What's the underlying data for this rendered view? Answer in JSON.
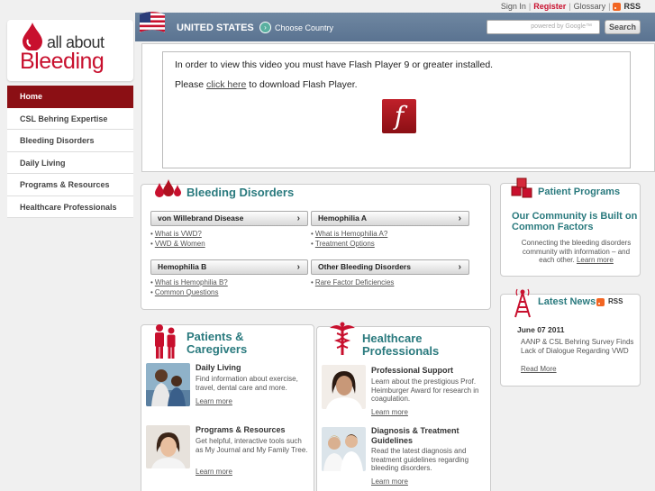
{
  "util": {
    "signin": "Sign In",
    "register": "Register",
    "glossary": "Glossary",
    "rss": "RSS"
  },
  "header": {
    "country": "UNITED STATES",
    "choose": "Choose Country",
    "search_placeholder": "powered by Google™",
    "search_button": "Search"
  },
  "logo": {
    "line1": "all about",
    "line2": "Bleeding"
  },
  "nav": [
    {
      "label": "Home"
    },
    {
      "label": "CSL Behring Expertise"
    },
    {
      "label": "Bleeding Disorders"
    },
    {
      "label": "Daily Living"
    },
    {
      "label": "Programs & Resources"
    },
    {
      "label": "Healthcare Professionals"
    }
  ],
  "video": {
    "msg1": "In order to view this video you must have Flash Player 9 or greater installed.",
    "msg2_pre": "Please ",
    "msg2_link": "click here",
    "msg2_post": " to download Flash Player.",
    "flash_glyph": "f"
  },
  "bleeding": {
    "title": "Bleeding Disorders",
    "vwd": {
      "label": "von Willebrand Disease",
      "links": [
        "What is VWD?",
        "VWD & Women"
      ]
    },
    "hemoA": {
      "label": "Hemophilia A",
      "links": [
        "What is Hemophilia A?",
        "Treatment Options"
      ]
    },
    "hemoB": {
      "label": "Hemophilia B",
      "links": [
        "What is Hemophilia B?",
        "Common Questions"
      ]
    },
    "other": {
      "label": "Other Bleeding Disorders",
      "links": [
        "Rare Factor Deficiencies"
      ]
    }
  },
  "programs": {
    "title": "Patient Programs",
    "headline": "Our Community is Built on Common Factors",
    "body": "Connecting the bleeding disorders community with information – and each other.",
    "more": "Learn more"
  },
  "news": {
    "title": "Latest News",
    "rss": "RSS",
    "date": "June 07 2011",
    "body": "AANP & CSL Behring Survey Finds Lack of Dialogue Regarding VWD",
    "more": "Read More"
  },
  "patients": {
    "title1": "Patients &",
    "title2": "Caregivers",
    "items": [
      {
        "head": "Daily Living",
        "body": "Find information about exercise, travel, dental care and more.",
        "more": "Learn more"
      },
      {
        "head": "Programs & Resources",
        "body": "Get helpful, interactive tools such as My Journal and My Family Tree.",
        "more": "Learn more"
      }
    ]
  },
  "hcp": {
    "title1": "Healthcare",
    "title2": "Professionals",
    "items": [
      {
        "head": "Professional Support",
        "body": "Learn about the prestigious Prof. Heimburger Award for research in coagulation.",
        "more": "Learn more"
      },
      {
        "head": "Diagnosis & Treatment Guidelines",
        "body": "Read the latest diagnosis and treatment guidelines regarding bleeding disorders.",
        "more": "Learn more"
      }
    ]
  },
  "colors": {
    "brand_red": "#c8102e",
    "nav_active": "#8b0f14",
    "teal": "#2a7a7e",
    "header_blue": "#5a7391"
  }
}
